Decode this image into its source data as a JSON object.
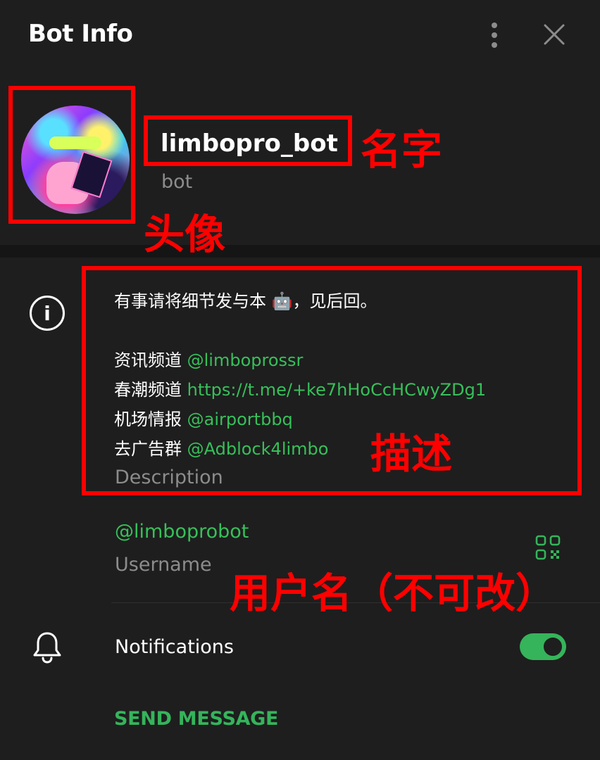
{
  "header": {
    "title": "Bot Info"
  },
  "profile": {
    "name": "limbopro_bot",
    "subtitle": "bot"
  },
  "description": {
    "intro": "有事请将细节发与本 🤖，见后回。",
    "links": [
      {
        "label": "资讯频道",
        "value": "@limboprossr"
      },
      {
        "label": "春潮频道",
        "value": "https://t.me/+ke7hHoCcHCwyZDg1"
      },
      {
        "label": "机场情报",
        "value": "@airportbbq"
      },
      {
        "label": "去广告群",
        "value": "@Adblock4limbo"
      }
    ],
    "label": "Description"
  },
  "username": {
    "value": "@limboprobot",
    "label": "Username"
  },
  "notifications": {
    "label": "Notifications",
    "enabled": true
  },
  "actions": {
    "send_message": "SEND MESSAGE"
  },
  "annotations": {
    "name": "名字",
    "avatar": "头像",
    "description": "描述",
    "username": "用户名（不可改）"
  },
  "colors": {
    "background": "#1e1e1e",
    "accent": "#35b45b",
    "annotation": "#ff0000",
    "muted": "#8c8c8c"
  }
}
